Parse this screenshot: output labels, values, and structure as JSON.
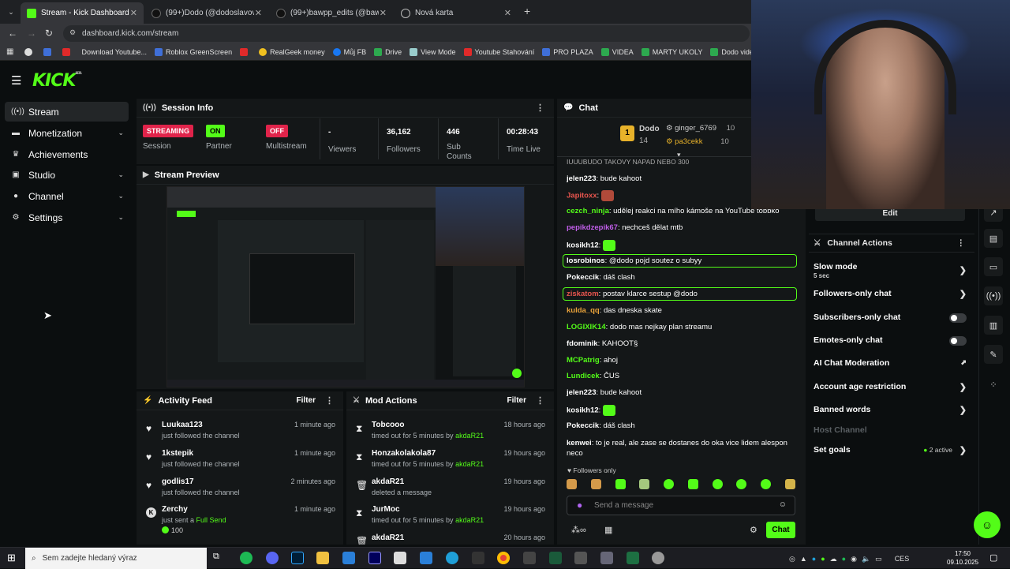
{
  "browser": {
    "tabs": [
      {
        "label": "Stream - Kick Dashboard",
        "active": true
      },
      {
        "label": "(99+)Dodo (@dodoslavovec) | T",
        "active": false
      },
      {
        "label": "(99+)bawpp_edits (@bawpp_ed",
        "active": false
      },
      {
        "label": "Nová karta",
        "active": false
      }
    ],
    "url": "dashboard.kick.com/stream",
    "bookmarks": [
      "Download Youtube...",
      "Roblox GreenScreen",
      "",
      "RealGeek money",
      "Můj FB",
      "Drive",
      "View Mode",
      "Youtube Stahování",
      "PRO PLAZA",
      "VIDEA",
      "MARTY UKOLY",
      "Dodo videa",
      "F"
    ]
  },
  "app": {
    "logo": "KICK",
    "logo_beta": "BETA"
  },
  "sidebar": {
    "items": [
      {
        "label": "Stream",
        "icon": "broadcast-icon",
        "active": true,
        "expandable": false
      },
      {
        "label": "Monetization",
        "icon": "wallet-icon",
        "expandable": true
      },
      {
        "label": "Achievements",
        "icon": "trophy-icon",
        "expandable": false
      },
      {
        "label": "Studio",
        "icon": "studio-icon",
        "expandable": true
      },
      {
        "label": "Channel",
        "icon": "person-icon",
        "expandable": true
      },
      {
        "label": "Settings",
        "icon": "gear-icon",
        "expandable": true
      }
    ]
  },
  "session": {
    "title": "Session Info",
    "stats": [
      {
        "badge": "STREAMING",
        "label": "Session"
      },
      {
        "badge": "ON",
        "label": "Partner Income"
      },
      {
        "badge": "OFF",
        "label": "Multistream"
      },
      {
        "value": "-",
        "label": "Viewers"
      },
      {
        "value": "36,162",
        "label": "Followers"
      },
      {
        "value": "446",
        "label": "Sub Counts"
      },
      {
        "value": "00:28:43",
        "label": "Time Live"
      }
    ]
  },
  "preview": {
    "title": "Stream Preview"
  },
  "activity": {
    "title": "Activity Feed",
    "filter": "Filter",
    "items": [
      {
        "name": "Luukaa123",
        "desc": "just followed the channel",
        "time": "1 minute ago"
      },
      {
        "name": "1kstepik",
        "desc": "just followed the channel",
        "time": "1 minute ago"
      },
      {
        "name": "godlis17",
        "desc": "just followed the channel",
        "time": "2 minutes ago"
      },
      {
        "name": "Zerchy",
        "desc": "just sent a",
        "desc_highlight": "Full Send",
        "amount": "100",
        "time": "1 minute ago"
      }
    ]
  },
  "mod": {
    "title": "Mod Actions",
    "filter": "Filter",
    "items": [
      {
        "name": "Tobcooo",
        "desc": "timed out for 5 minutes by",
        "by": "akdaR21",
        "time": "18 hours ago"
      },
      {
        "name": "Honzakolakola87",
        "desc": "timed out for 5 minutes by",
        "by": "akdaR21",
        "time": "19 hours ago"
      },
      {
        "name": "akdaR21",
        "desc": "deleted a message",
        "by": "",
        "time": "19 hours ago"
      },
      {
        "name": "JurMoc",
        "desc": "timed out for 5 minutes by",
        "by": "akdaR21",
        "time": "19 hours ago"
      },
      {
        "name": "akdaR21",
        "desc": "",
        "by": "",
        "time": "20 hours ago"
      }
    ]
  },
  "chat": {
    "title": "Chat",
    "leaders": {
      "first": "Dodo",
      "first_num": "14",
      "rank": "1",
      "second": "ginger_6769",
      "second_num": "10",
      "third": "pa3cekk",
      "third_num": "10"
    },
    "cut_line": "IUUUBUDO TAKOVY NAPAD NEBO 300",
    "messages": [
      {
        "user": "jelen223",
        "text": "bude kahoot",
        "color": "#ffffff"
      },
      {
        "user": "Japitoxx",
        "text": "",
        "color": "#e8554e"
      },
      {
        "user": "cezch_ninja",
        "text": "udělej reakci na mího kámoše na YouTube tobbko",
        "color": "#53fc18"
      },
      {
        "user": "pepikdzepik67",
        "text": "nechceš dělat mtb",
        "color": "#c05ee8"
      },
      {
        "user": "kosikh12",
        "text": "",
        "color": "#ffffff"
      },
      {
        "user": "losrobinos",
        "text": "@dodo pojd soutez o subyy",
        "color": "#ffffff",
        "highlight": true
      },
      {
        "user": "Pokeccik",
        "text": "dáš clash",
        "color": "#ffffff"
      },
      {
        "user": "ziskatom",
        "text": "postav klarce sestup @dodo",
        "color": "#e8554e",
        "highlight": true
      },
      {
        "user": "kulda_qq",
        "text": "das dneska skate",
        "color": "#e8a23a"
      },
      {
        "user": "LOGIXIK14",
        "text": "dodo mas nejkay plan streamu",
        "color": "#53fc18"
      },
      {
        "user": "fdominik",
        "text": "KAHOOT§",
        "color": "#ffffff"
      },
      {
        "user": "MCPatrig",
        "text": "ahoj",
        "color": "#53fc18"
      },
      {
        "user": "Lundicek",
        "text": "ČUS",
        "color": "#53fc18"
      },
      {
        "user": "jelen223",
        "text": "bude kahoot",
        "color": "#ffffff"
      },
      {
        "user": "kosikh12",
        "text": "",
        "color": "#ffffff"
      },
      {
        "user": "Pokeccik",
        "text": "dáš clash",
        "color": "#ffffff"
      },
      {
        "user": "kenwei",
        "text": "to je real, ale zase se dostanes do oka vice lidem alespon neco",
        "color": "#ffffff"
      }
    ],
    "followers_only": "Followers only",
    "input_placeholder": "Send a message",
    "send": "Chat"
  },
  "channel_actions": {
    "edit": "Edit",
    "title": "Channel Actions",
    "items": [
      {
        "label": "Slow mode",
        "sub": "5 sec",
        "control": "chevron"
      },
      {
        "label": "Followers-only chat",
        "control": "chevron"
      },
      {
        "label": "Subscribers-only chat",
        "control": "toggle"
      },
      {
        "label": "Emotes-only chat",
        "control": "toggle"
      },
      {
        "label": "AI Chat Moderation",
        "control": "external"
      },
      {
        "label": "Account age restriction",
        "control": "chevron"
      },
      {
        "label": "Banned words",
        "control": "chevron"
      },
      {
        "label": "Host Channel",
        "control": "none",
        "disabled": true
      },
      {
        "label": "Set goals",
        "control": "chevron",
        "status": "2 active"
      }
    ]
  },
  "taskbar": {
    "search_placeholder": "Sem zadejte hledaný výraz",
    "lang": "CES",
    "time": "17:50",
    "date": "09.10.2025"
  },
  "colors": {
    "accent": "#53fc18",
    "streaming": "#e0234a",
    "on": "#53fc18",
    "off": "#e0234a",
    "panel": "#141718",
    "bg": "#0b0e0f"
  }
}
